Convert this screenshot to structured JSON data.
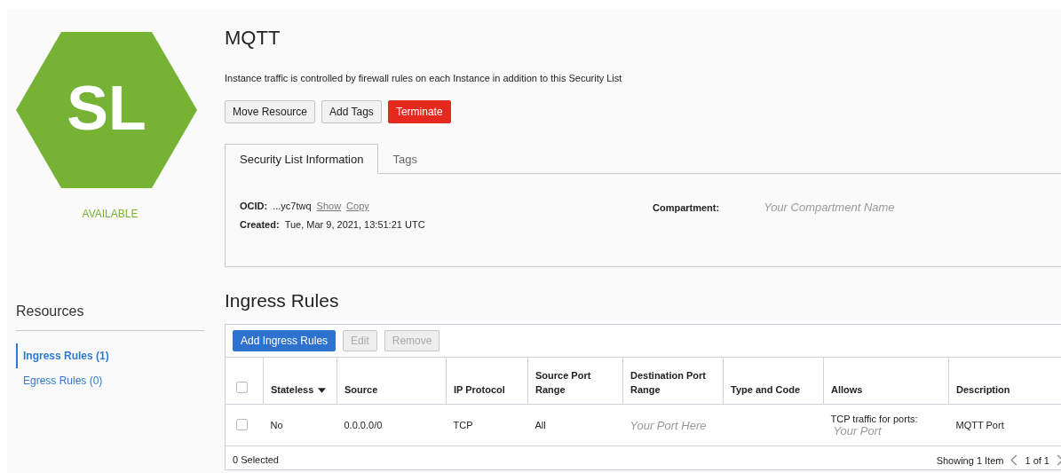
{
  "badge": {
    "initials": "SL",
    "status": "AVAILABLE"
  },
  "title": "MQTT",
  "description": "Instance traffic is controlled by firewall rules on each Instance in addition to this Security List",
  "actions": [
    {
      "label": "Move Resource",
      "kind": "default"
    },
    {
      "label": "Add Tags",
      "kind": "default"
    },
    {
      "label": "Terminate",
      "kind": "danger"
    }
  ],
  "tabs": [
    {
      "label": "Security List Information",
      "selected": true
    },
    {
      "label": "Tags",
      "selected": false
    }
  ],
  "info": {
    "ocid_label": "OCID:",
    "ocid": "...yc7twq",
    "show": "Show",
    "copy": "Copy",
    "created_label": "Created:",
    "created": "Tue, Mar 9, 2021, 13:51:21 UTC",
    "compartment_label": "Compartment:",
    "compartment": "Your Compartment Name"
  },
  "resources": {
    "title": "Resources",
    "items": [
      {
        "label": "Ingress Rules (1)",
        "selected": true
      },
      {
        "label": "Egress Rules (0)",
        "selected": false
      }
    ]
  },
  "section_title": "Ingress Rules",
  "toolbar": [
    {
      "label": "Add Ingress Rules",
      "kind": "primary",
      "disabled": false
    },
    {
      "label": "Edit",
      "kind": "default",
      "disabled": true
    },
    {
      "label": "Remove",
      "kind": "default",
      "disabled": true
    }
  ],
  "table": {
    "select_all_checked": false,
    "columns": [
      {
        "label": "Stateless",
        "sorted": true
      },
      {
        "label": "Source",
        "sorted": false
      },
      {
        "label": "IP Protocol",
        "sorted": false
      },
      {
        "label": "Source Port Range",
        "sorted": false
      },
      {
        "label": "Destination Port Range",
        "sorted": false
      },
      {
        "label": "Type and Code",
        "sorted": false
      },
      {
        "label": "Allows",
        "sorted": false
      },
      {
        "label": "Description",
        "sorted": false
      }
    ],
    "rows": [
      {
        "checked": false,
        "stateless": "No",
        "source": "0.0.0.0/0",
        "ip_protocol": "TCP",
        "source_port_range": "All",
        "destination_port_range": "Your Port Here",
        "allows": "TCP traffic for ports:",
        "allows_port": "Your Port",
        "description": "MQTT Port"
      }
    ],
    "selected_count": "0 Selected",
    "showing": "Showing 1 Item",
    "page": "1 of 1"
  }
}
